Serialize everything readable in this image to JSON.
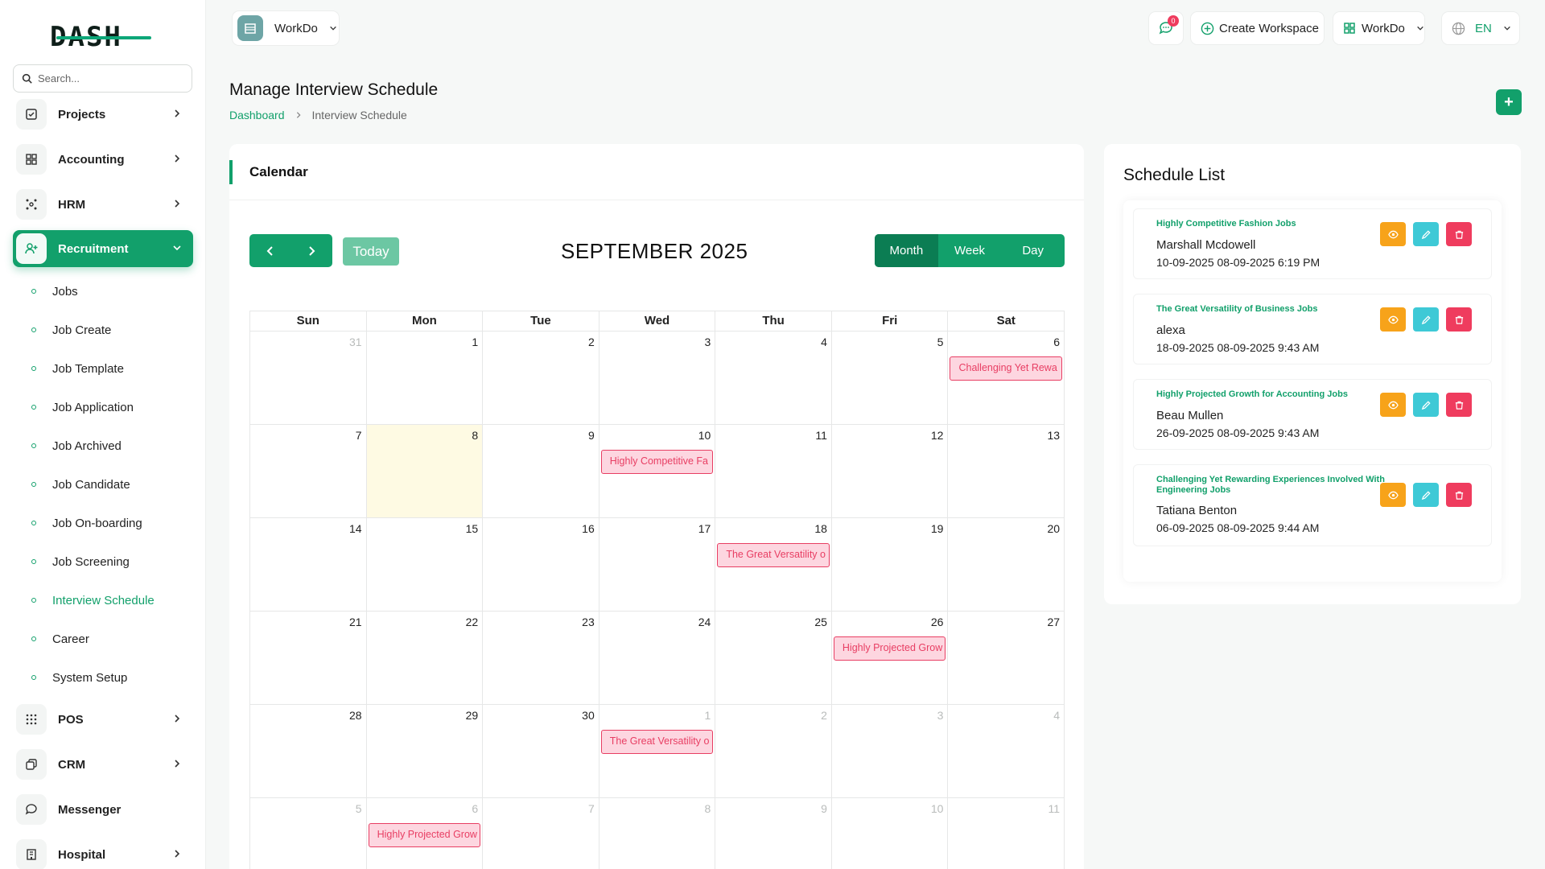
{
  "logo": {
    "text": "DASH"
  },
  "search": {
    "placeholder": "Search..."
  },
  "sidebar": {
    "items": [
      {
        "label": "Projects",
        "icon": "checkbox-icon",
        "has_chevron": true
      },
      {
        "label": "Accounting",
        "icon": "grid-icon",
        "has_chevron": true
      },
      {
        "label": "HRM",
        "icon": "network-icon",
        "has_chevron": true
      },
      {
        "label": "Recruitment",
        "icon": "user-plus-icon",
        "has_chevron": true,
        "active": true
      },
      {
        "label": "POS",
        "icon": "dots-grid-icon",
        "has_chevron": true
      },
      {
        "label": "CRM",
        "icon": "layers-icon",
        "has_chevron": true
      },
      {
        "label": "Messenger",
        "icon": "chat-icon",
        "has_chevron": false
      },
      {
        "label": "Hospital",
        "icon": "building-icon",
        "has_chevron": true
      }
    ],
    "recruitment_sub": [
      "Jobs",
      "Job Create",
      "Job Template",
      "Job Application",
      "Job Archived",
      "Job Candidate",
      "Job On-boarding",
      "Job Screening",
      "Interview Schedule",
      "Career",
      "System Setup"
    ],
    "active_sub": "Interview Schedule"
  },
  "topbar": {
    "workspace": "WorkDo",
    "notification_count": "0",
    "create_workspace": "Create Workspace",
    "workspace_menu": "WorkDo",
    "language": "EN"
  },
  "page": {
    "title": "Manage Interview Schedule",
    "breadcrumb": [
      "Dashboard",
      "Interview Schedule"
    ],
    "add_label": "+"
  },
  "calendar": {
    "card_title": "Calendar",
    "today_label": "Today",
    "month_title": "SEPTEMBER 2025",
    "views": [
      "Month",
      "Week",
      "Day"
    ],
    "selected_view": "Month",
    "weekdays": [
      "Sun",
      "Mon",
      "Tue",
      "Wed",
      "Thu",
      "Fri",
      "Sat"
    ],
    "weeks": [
      [
        {
          "d": "31",
          "o": true
        },
        {
          "d": "1"
        },
        {
          "d": "2"
        },
        {
          "d": "3"
        },
        {
          "d": "4"
        },
        {
          "d": "5"
        },
        {
          "d": "6",
          "e": "Challenging Yet Rewa"
        }
      ],
      [
        {
          "d": "7"
        },
        {
          "d": "8",
          "t": true
        },
        {
          "d": "9"
        },
        {
          "d": "10",
          "e": "Highly Competitive Fa"
        },
        {
          "d": "11"
        },
        {
          "d": "12"
        },
        {
          "d": "13"
        }
      ],
      [
        {
          "d": "14"
        },
        {
          "d": "15"
        },
        {
          "d": "16"
        },
        {
          "d": "17"
        },
        {
          "d": "18",
          "e": "The Great Versatility o"
        },
        {
          "d": "19"
        },
        {
          "d": "20"
        }
      ],
      [
        {
          "d": "21"
        },
        {
          "d": "22"
        },
        {
          "d": "23"
        },
        {
          "d": "24"
        },
        {
          "d": "25"
        },
        {
          "d": "26",
          "e": "Highly Projected Grow"
        },
        {
          "d": "27"
        }
      ],
      [
        {
          "d": "28"
        },
        {
          "d": "29"
        },
        {
          "d": "30"
        },
        {
          "d": "1",
          "o": true,
          "e": "The Great Versatility o"
        },
        {
          "d": "2",
          "o": true
        },
        {
          "d": "3",
          "o": true
        },
        {
          "d": "4",
          "o": true
        }
      ],
      [
        {
          "d": "5",
          "o": true
        },
        {
          "d": "6",
          "o": true,
          "e": "Highly Projected Grow"
        },
        {
          "d": "7",
          "o": true
        },
        {
          "d": "8",
          "o": true
        },
        {
          "d": "9",
          "o": true
        },
        {
          "d": "10",
          "o": true
        },
        {
          "d": "11",
          "o": true
        }
      ]
    ]
  },
  "schedule": {
    "title": "Schedule List",
    "items": [
      {
        "job": "Highly Competitive Fashion Jobs",
        "name": "Marshall Mcdowell",
        "date": "10-09-2025 08-09-2025 6:19 PM"
      },
      {
        "job": "The Great Versatility of Business Jobs",
        "name": "alexa",
        "date": "18-09-2025 08-09-2025 9:43 AM"
      },
      {
        "job": "Highly Projected Growth for Accounting Jobs",
        "name": "Beau Mullen",
        "date": "26-09-2025 08-09-2025 9:43 AM"
      },
      {
        "job": "Challenging Yet Rewarding Experiences Involved With Engineering Jobs",
        "name": "Tatiana Benton",
        "date": "06-09-2025 08-09-2025 9:44 AM"
      }
    ]
  },
  "colors": {
    "accent": "#12a06b",
    "event_bg": "#fdd6e0",
    "event_border": "#e83e63",
    "view_btn": "#f7a31a",
    "edit_btn": "#3ec9d6",
    "delete_btn": "#ef3c5e"
  }
}
